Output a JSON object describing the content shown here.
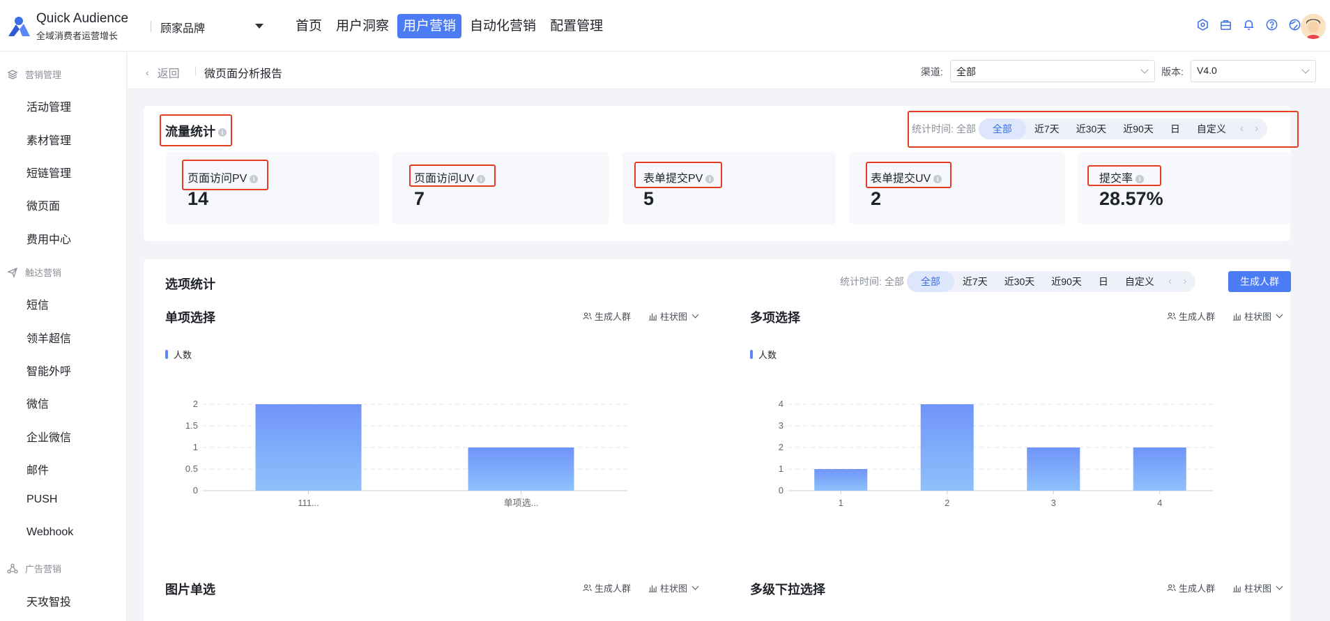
{
  "app": {
    "name": "Quick Audience",
    "subtitle": "全域消费者运营增长",
    "brand": "顾家品牌",
    "nav": [
      {
        "label": "首页",
        "active": false
      },
      {
        "label": "用户洞察",
        "active": false
      },
      {
        "label": "用户营销",
        "active": true
      },
      {
        "label": "自动化营销",
        "active": false
      },
      {
        "label": "配置管理",
        "active": false
      }
    ],
    "top_icons": [
      "gift-icon",
      "briefcase-icon",
      "bell-icon",
      "help-icon",
      "globe-icon"
    ]
  },
  "sidebar": {
    "groups": [
      {
        "label": "营销管理",
        "icon": "layers-icon",
        "items": [
          "活动管理",
          "素材管理",
          "短链管理",
          "微页面",
          "费用中心"
        ]
      },
      {
        "label": "触达营销",
        "icon": "send-icon",
        "items": [
          "短信",
          "领羊超信",
          "智能外呼",
          "微信",
          "企业微信",
          "邮件",
          "PUSH",
          "Webhook"
        ]
      },
      {
        "label": "广告营销",
        "icon": "share-icon",
        "items": [
          "天攻智投"
        ]
      }
    ]
  },
  "header": {
    "back": "返回",
    "title": "微页面分析报告",
    "channel_label": "渠道:",
    "channel_value": "全部",
    "version_label": "版本:",
    "version_value": "V4.0"
  },
  "traffic": {
    "title": "流量统计",
    "range_label": "统计时间:",
    "range_all": "全部",
    "range_options": [
      "全部",
      "近7天",
      "近30天",
      "近90天",
      "日",
      "自定义"
    ],
    "range_selected": "全部",
    "metrics": [
      {
        "label": "页面访问PV",
        "value": "14"
      },
      {
        "label": "页面访问UV",
        "value": "7"
      },
      {
        "label": "表单提交PV",
        "value": "5"
      },
      {
        "label": "表单提交UV",
        "value": "2"
      },
      {
        "label": "提交率",
        "value": "28.57%"
      }
    ]
  },
  "options": {
    "title": "选项统计",
    "range_label": "统计时间:",
    "range_all": "全部",
    "range_options": [
      "全部",
      "近7天",
      "近30天",
      "近90天",
      "日",
      "自定义"
    ],
    "range_selected": "全部",
    "generate_button": "生成人群",
    "generate_link": "生成人群",
    "chart_type": "柱状图",
    "legend": "人数",
    "sections": [
      "单项选择",
      "多项选择",
      "图片单选",
      "多级下拉选择"
    ]
  },
  "chart_data": [
    {
      "type": "bar",
      "title": "单项选择",
      "categories": [
        "111...",
        "单项选..."
      ],
      "series": [
        {
          "name": "人数",
          "values": [
            2,
            1
          ]
        }
      ],
      "ylim": [
        0,
        2
      ],
      "yticks": [
        "0",
        "0.5",
        "1",
        "1.5",
        "2"
      ],
      "color": "#6f98fb",
      "grid": true
    },
    {
      "type": "bar",
      "title": "多项选择",
      "categories": [
        "1",
        "2",
        "3",
        "4"
      ],
      "series": [
        {
          "name": "人数",
          "values": [
            1,
            4,
            2,
            2
          ]
        }
      ],
      "ylim": [
        0,
        4
      ],
      "yticks": [
        "0",
        "1",
        "2",
        "3",
        "4"
      ],
      "color": "#6f98fb",
      "grid": true
    }
  ]
}
